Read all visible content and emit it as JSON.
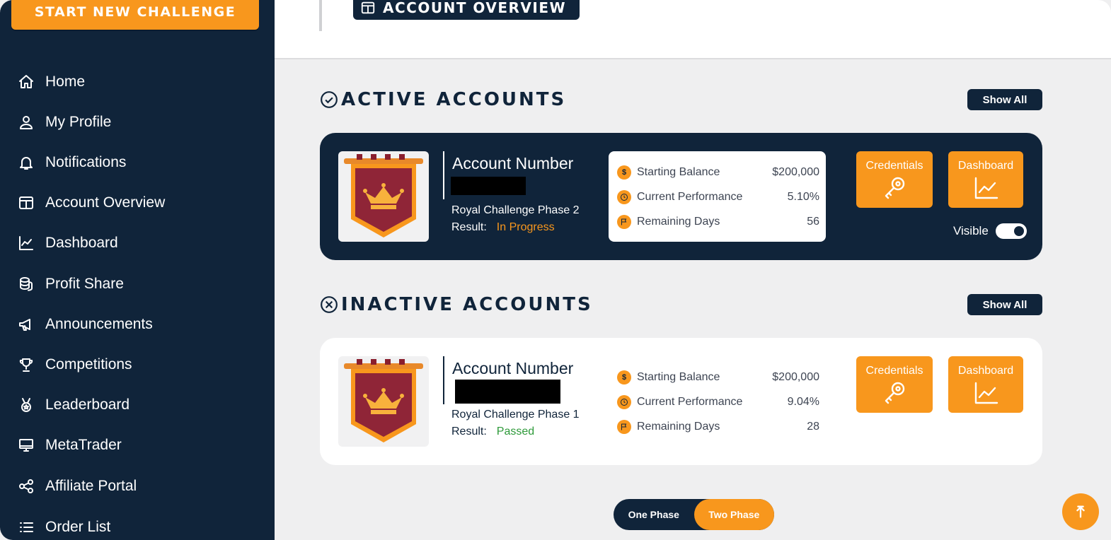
{
  "sidebar": {
    "cta_label": "START NEW CHALLENGE",
    "items": [
      {
        "label": "Home",
        "icon": "home-icon"
      },
      {
        "label": "My Profile",
        "icon": "user-icon"
      },
      {
        "label": "Notifications",
        "icon": "bell-icon"
      },
      {
        "label": "Account Overview",
        "icon": "columns-icon"
      },
      {
        "label": "Dashboard",
        "icon": "chart-line-icon"
      },
      {
        "label": "Profit Share",
        "icon": "coins-icon"
      },
      {
        "label": "Announcements",
        "icon": "megaphone-icon"
      },
      {
        "label": "Competitions",
        "icon": "trophy-icon"
      },
      {
        "label": "Leaderboard",
        "icon": "medal-icon"
      },
      {
        "label": "MetaTrader",
        "icon": "monitor-icon"
      },
      {
        "label": "Affiliate Portal",
        "icon": "share-icon"
      },
      {
        "label": "Order List",
        "icon": "list-icon"
      }
    ]
  },
  "header": {
    "page_title": "ACCOUNT OVERVIEW"
  },
  "active_section": {
    "title": "ACTIVE ACCOUNTS",
    "show_all_label": "Show All",
    "card": {
      "account_label": "Account Number",
      "phase": "Royal Challenge Phase 2",
      "result_label": "Result:",
      "result_value": "In Progress",
      "stats": [
        {
          "label": "Starting Balance",
          "value": "$200,000"
        },
        {
          "label": "Current Performance",
          "value": "5.10%"
        },
        {
          "label": "Remaining Days",
          "value": "56"
        }
      ],
      "credentials_label": "Credentials",
      "dashboard_label": "Dashboard",
      "visible_label": "Visible"
    }
  },
  "inactive_section": {
    "title": "INACTIVE ACCOUNTS",
    "show_all_label": "Show All",
    "card": {
      "account_label": "Account Number",
      "phase": "Royal Challenge Phase 1",
      "result_label": "Result:",
      "result_value": "Passed",
      "stats": [
        {
          "label": "Starting Balance",
          "value": "$200,000"
        },
        {
          "label": "Current Performance",
          "value": "9.04%"
        },
        {
          "label": "Remaining Days",
          "value": "28"
        }
      ],
      "credentials_label": "Credentials",
      "dashboard_label": "Dashboard"
    }
  },
  "phase_switch": {
    "one": "One Phase",
    "two": "Two Phase",
    "selected": "Two Phase"
  },
  "colors": {
    "navy": "#10243a",
    "orange": "#f8971d",
    "in_progress": "#f8971d",
    "passed": "#2e9a3a"
  }
}
